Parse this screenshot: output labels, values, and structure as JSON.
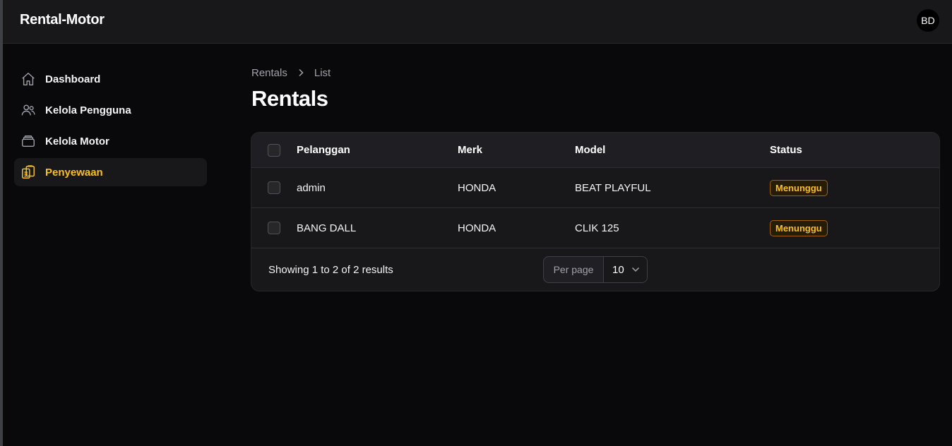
{
  "app": {
    "title": "Rental-Motor",
    "avatar_initials": "BD"
  },
  "sidebar": {
    "items": [
      {
        "label": "Dashboard",
        "icon": "home-icon",
        "active": false
      },
      {
        "label": "Kelola Pengguna",
        "icon": "users-icon",
        "active": false
      },
      {
        "label": "Kelola Motor",
        "icon": "stack-icon",
        "active": false
      },
      {
        "label": "Penyewaan",
        "icon": "clipboard-icon",
        "active": true
      }
    ]
  },
  "breadcrumb": {
    "parent": "Rentals",
    "current": "List"
  },
  "page": {
    "title": "Rentals"
  },
  "table": {
    "columns": {
      "customer": "Pelanggan",
      "brand": "Merk",
      "model": "Model",
      "status": "Status"
    },
    "rows": [
      {
        "customer": "admin",
        "brand": "HONDA",
        "model": "BEAT PLAYFUL",
        "status": "Menunggu"
      },
      {
        "customer": "BANG DALL",
        "brand": "HONDA",
        "model": "CLIK 125",
        "status": "Menunggu"
      }
    ],
    "footer": {
      "showing": "Showing 1 to 2 of 2 results",
      "per_page_label": "Per page",
      "per_page_value": "10"
    }
  },
  "colors": {
    "accent": "#fbbf24",
    "background": "#09090b",
    "surface": "#18181b"
  }
}
